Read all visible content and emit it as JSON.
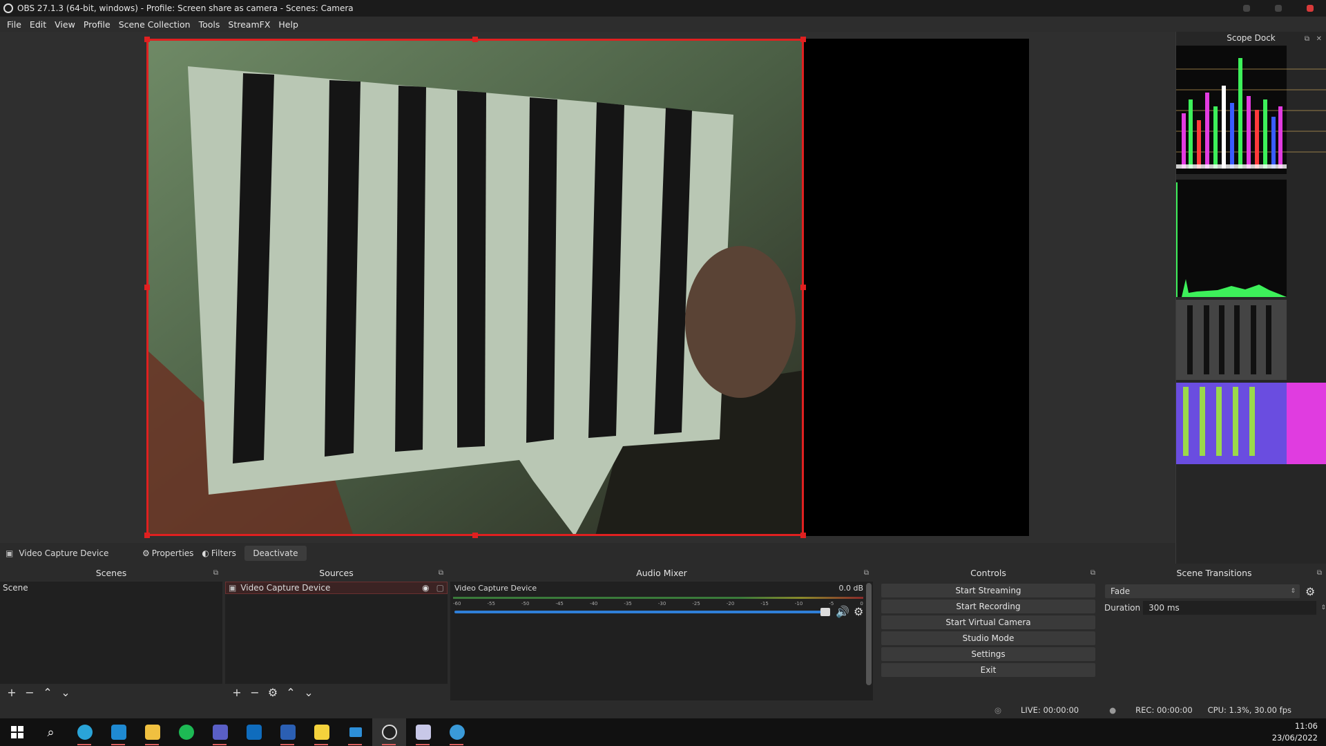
{
  "window": {
    "title": "OBS 27.1.3 (64-bit, windows) - Profile: Screen share as camera - Scenes: Camera"
  },
  "menu": [
    "File",
    "Edit",
    "View",
    "Profile",
    "Scene Collection",
    "Tools",
    "StreamFX",
    "Help"
  ],
  "scope_dock": {
    "title": "Scope Dock"
  },
  "source_toolbar": {
    "current_source": "Video Capture Device",
    "properties": "Properties",
    "filters": "Filters",
    "deactivate": "Deactivate"
  },
  "scenes": {
    "title": "Scenes",
    "items": [
      "Scene"
    ]
  },
  "sources": {
    "title": "Sources",
    "items": [
      "Video Capture Device"
    ]
  },
  "audio_mixer": {
    "title": "Audio Mixer",
    "channel": "Video Capture Device",
    "db": "0.0 dB",
    "scale": [
      "-60",
      "-55",
      "-50",
      "-45",
      "-40",
      "-35",
      "-30",
      "-25",
      "-20",
      "-15",
      "-10",
      "-5",
      "0"
    ]
  },
  "controls": {
    "title": "Controls",
    "buttons": [
      "Start Streaming",
      "Start Recording",
      "Start Virtual Camera",
      "Studio Mode",
      "Settings",
      "Exit"
    ]
  },
  "transitions": {
    "title": "Scene Transitions",
    "selected": "Fade",
    "duration_label": "Duration",
    "duration": "300 ms"
  },
  "status": {
    "live": "LIVE: 00:00:00",
    "rec": "REC: 00:00:00",
    "cpu": "CPU: 1.3%, 30.00 fps"
  },
  "clock": {
    "time": "11:06",
    "date": "23/06/2022"
  },
  "colors": {
    "selection": "#e02020",
    "volume_bar": "#2f7fd8",
    "accent": "#6ab04c"
  }
}
